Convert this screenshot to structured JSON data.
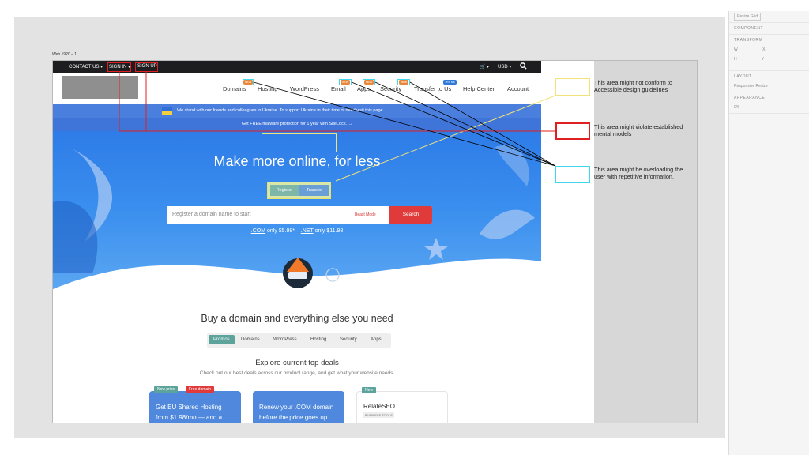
{
  "frame": {
    "label": "Web 1920 – 1"
  },
  "topbar": {
    "contact": "CONTACT US ▾",
    "sign_in": "SIGN IN ▾",
    "sign_up": "SIGN UP",
    "cart": "🛒 ▾",
    "currency": "USD ▾",
    "search_icon": "search-icon"
  },
  "nav": {
    "items": [
      "Domains",
      "Hosting",
      "WordPress",
      "Email",
      "Apps",
      "Security",
      "Transfer to Us",
      "Help Center",
      "Account"
    ],
    "badge_new": "NEW",
    "badge_tryme": "TRY ME"
  },
  "banner": {
    "ukraine": "We stand with our friends and colleagues in Ukraine. To support Ukraine in their time of need visit this page.",
    "promo": "Get FREE malware protection for 1 year with SiteLock. →"
  },
  "hero": {
    "title": "Make more online, for less",
    "tab_register": "Register",
    "tab_transfer": "Transfer",
    "search_placeholder": "Register a domain name to start",
    "beast_mode": "Beast Mode",
    "search_button": "Search",
    "com_label": ".COM",
    "com_price": " only $5.98*",
    "net_label": ".NET",
    "net_price": " only $11.98"
  },
  "section": {
    "title": "Buy a domain and everything else you need",
    "tabs": [
      "Promos",
      "Domains",
      "WordPress",
      "Hosting",
      "Security",
      "Apps"
    ]
  },
  "deals": {
    "title": "Explore current top deals",
    "subtitle": "Check out our best deals across our product range, and get what your website needs.",
    "cards": [
      {
        "tag1": "New price",
        "tag2": "Free domain",
        "text": "Get EU Shared Hosting from $1.98/mo — and a"
      },
      {
        "text": "Renew your .COM domain before the price goes up."
      },
      {
        "tag1": "New",
        "title": "RelateSEO",
        "subtag": "BUSINESS TOOLS"
      }
    ]
  },
  "annotations": [
    {
      "text": "This area might not conform to Accessible design guidelines",
      "color": "#f3e27a"
    },
    {
      "text": "This area might violate established mental models",
      "color": "#e02020"
    },
    {
      "text": "This area might be overloading the user with repetitive information.",
      "color": "#3fd6ee"
    }
  ],
  "inspector": {
    "resize": "Resize Grid",
    "component": "COMPONENT",
    "transform": "TRANSFORM",
    "x": "X",
    "y": "Y",
    "w": "W",
    "h": "H",
    "layout": "LAYOUT",
    "responsive": "Responsive Resize",
    "appearance": "APPEARANCE",
    "opacity": "0%"
  }
}
